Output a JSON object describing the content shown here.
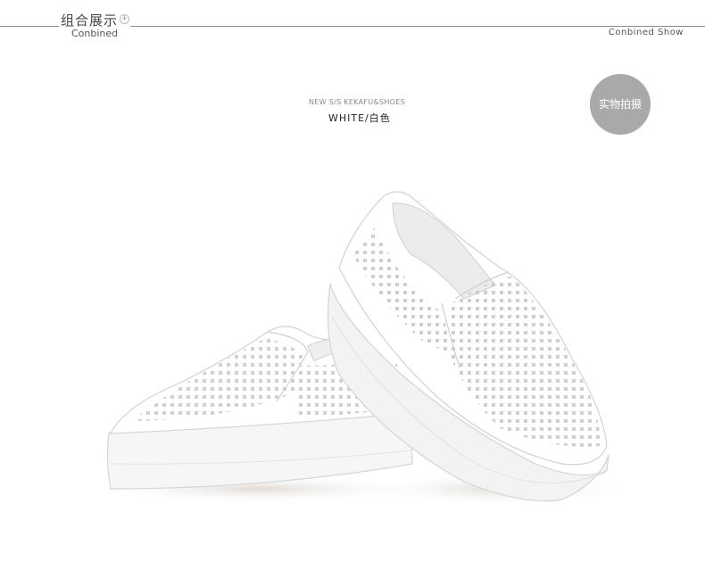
{
  "header": {
    "title": "组合展示",
    "subtitle": "Conbined",
    "right_label": "Conbined Show",
    "plus_glyph": "+"
  },
  "product": {
    "tagline": "NEW S/S KEKAFU&SHOES",
    "color_label": "WHITE/白色",
    "badge": "实物拍摄",
    "shoe_color": "#ffffff",
    "badge_color": "#a9a9a9"
  }
}
